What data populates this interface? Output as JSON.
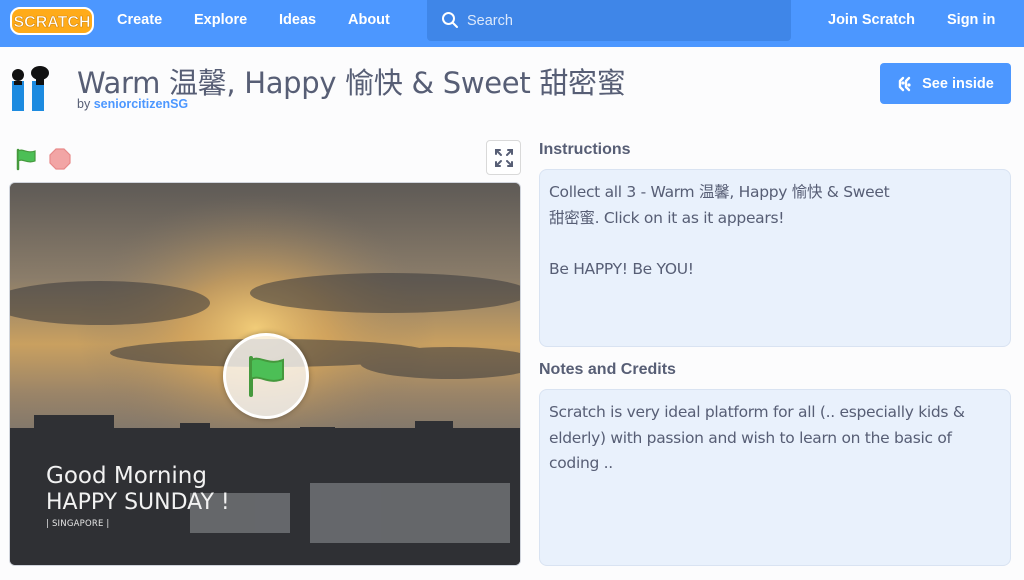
{
  "nav": {
    "logo": "SCRATCH",
    "links": [
      "Create",
      "Explore",
      "Ideas",
      "About"
    ],
    "search_placeholder": "Search",
    "join": "Join Scratch",
    "sign_in": "Sign in"
  },
  "project": {
    "title": "Warm 温馨, Happy 愉快 & Sweet 甜密蜜",
    "by": "by",
    "author": "seniorcitizenSG",
    "see_inside": "See inside"
  },
  "stage": {
    "line1": "Good Morning",
    "line2": "HAPPY SUNDAY !",
    "line3": "| SINGAPORE |"
  },
  "instructions": {
    "heading": "Instructions",
    "text": "Collect all 3 - Warm 温馨, Happy 愉快 & Sweet\n甜密蜜. Click on it as it appears!\n\nBe HAPPY! Be YOU!"
  },
  "notes": {
    "heading": "Notes and Credits",
    "text": "Scratch is very ideal platform for all (.. especially kids &\nelderly) with passion and wish to learn on the basic of\ncoding .."
  },
  "colors": {
    "brand": "#4c97ff",
    "flag": "#4cbf56",
    "stop": "#ec5959"
  }
}
